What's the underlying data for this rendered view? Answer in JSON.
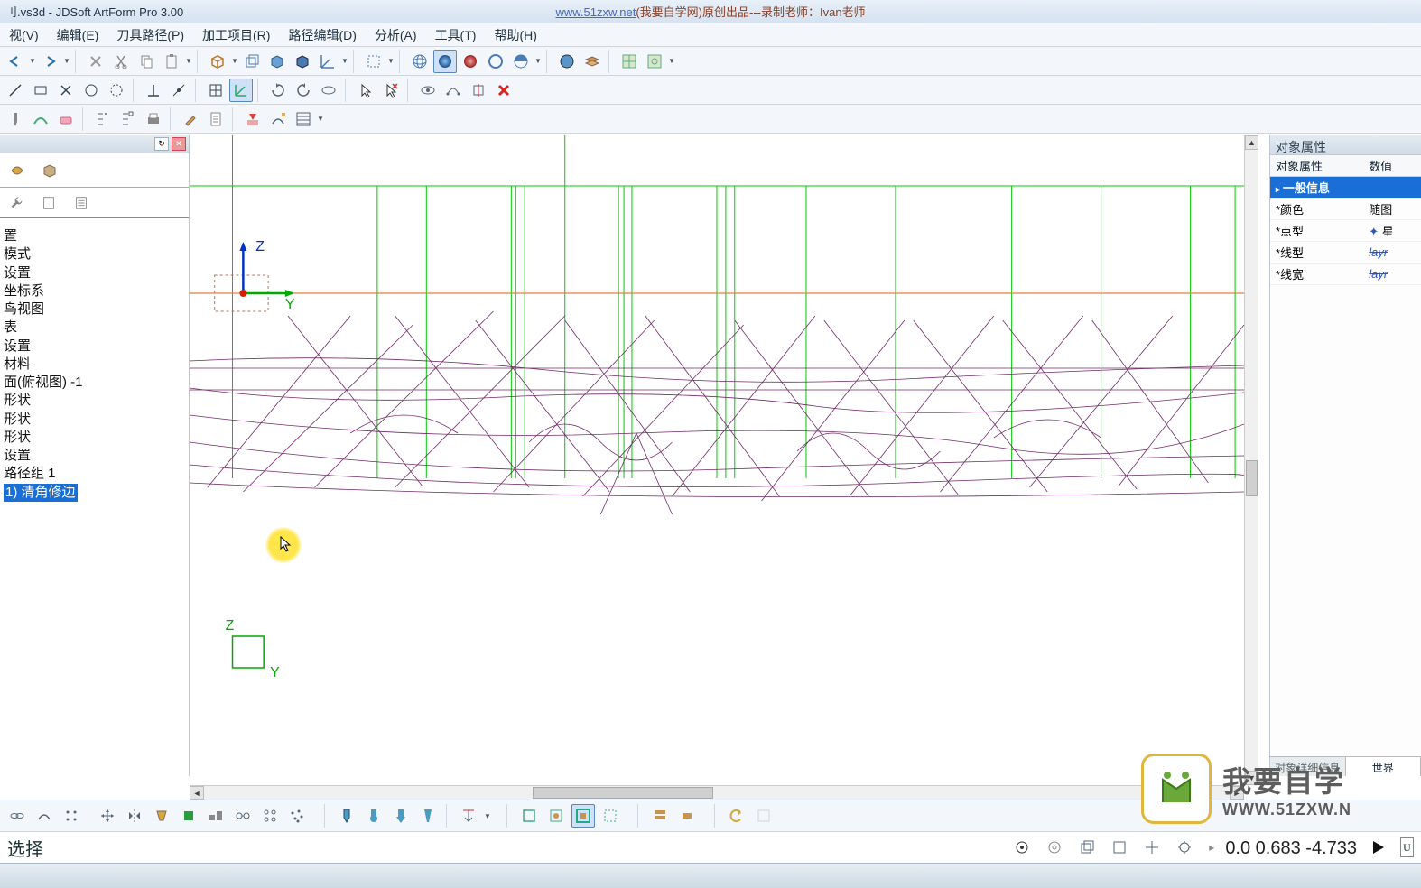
{
  "title": {
    "file": "刂.vs3d - JDSoft ArtForm Pro 3.00",
    "url": "www.51zxw.net",
    "url_desc": "(我要自学网)原创出品---录制老师：Ivan老师"
  },
  "menu": {
    "view": "视(V)",
    "edit": "编辑(E)",
    "toolpath": "刀具路径(P)",
    "machining": "加工项目(R)",
    "pathedit": "路径编辑(D)",
    "analyze": "分析(A)",
    "tools": "工具(T)",
    "help": "帮助(H)"
  },
  "left_tree": {
    "items": [
      "置",
      "模式",
      "设置",
      "坐标系",
      "鸟视图",
      "表",
      "设置",
      "材料",
      "面(俯视图) -1",
      "形状",
      "形状",
      "形状",
      "设置",
      "路径组 1"
    ],
    "selected": "1) 清角修边"
  },
  "props": {
    "panel_title": "对象属性",
    "col_name": "对象属性",
    "col_value": "数值",
    "section": "一般信息",
    "rows": [
      {
        "k": "*颜色",
        "v": "随图"
      },
      {
        "k": "*点型",
        "v": "星"
      },
      {
        "k": "*线型",
        "v": "layr"
      },
      {
        "k": "*线宽",
        "v": "layr"
      }
    ],
    "tab1": "对象详细信息",
    "tab2": "世界"
  },
  "status": {
    "left": "选择",
    "coords": "0.0 0.683 -4.733",
    "u": "U"
  },
  "axis": {
    "z": "Z",
    "y": "Y"
  },
  "wm": {
    "big": "我要自学",
    "url": "WWW.51ZXW.N"
  }
}
